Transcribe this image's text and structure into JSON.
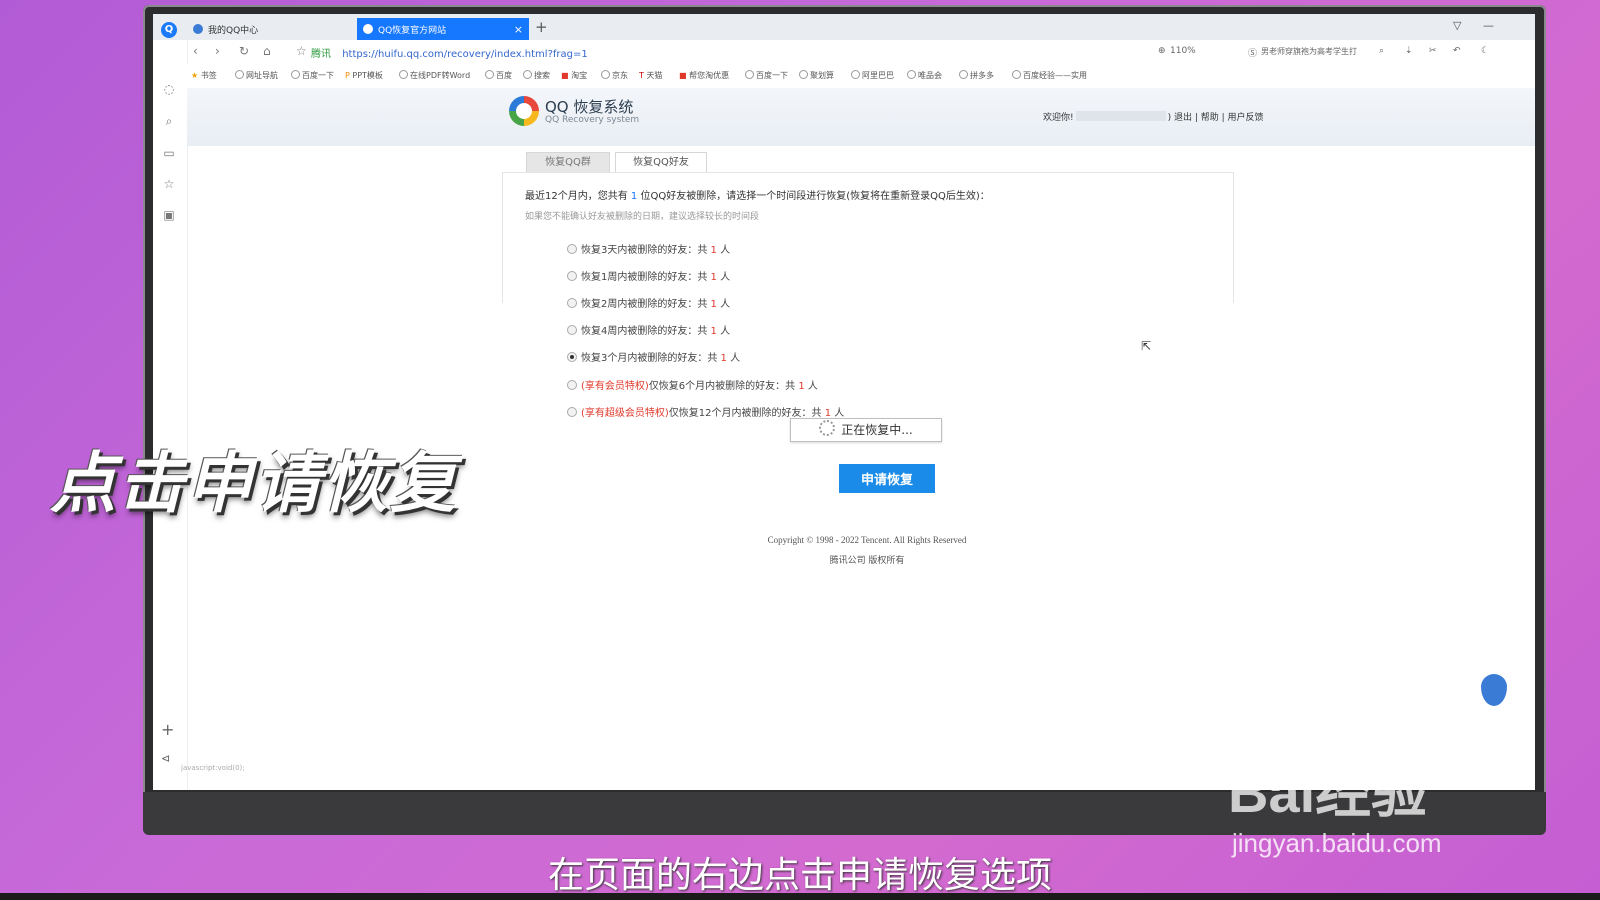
{
  "browser": {
    "tabs": [
      {
        "label": "我的QQ中心"
      },
      {
        "label": "QQ恢复官方网站"
      }
    ],
    "new_tab": "+",
    "site_name": "腾讯",
    "url": "https://huifu.qq.com/recovery/index.html?frag=1",
    "zoom": "110%",
    "search_hint": "男老师穿旗袍为高考学生打",
    "bookmarks": [
      "书签",
      "网址导航",
      "百度一下",
      "PPT模板",
      "在线PDF转Word",
      "百度",
      "搜索",
      "淘宝",
      "京东",
      "天猫",
      "帮您淘优惠",
      "百度一下",
      "聚划算",
      "阿里巴巴",
      "唯品会",
      "拼多多",
      "百度经验——实用"
    ],
    "status_url": "javascript:void(0);"
  },
  "page": {
    "logo_title": "QQ 恢复系统",
    "logo_sub": "QQ Recovery system",
    "welcome_prefix": "欢迎你!",
    "welcome_suffix": ") 退出 | 帮助 | 用户反馈",
    "tabs": [
      "恢复QQ群",
      "恢复QQ好友"
    ],
    "intro_pre": "最近12个月内，您共有 ",
    "intro_num": "1",
    "intro_post": " 位QQ好友被删除，请选择一个时间段进行恢复(恢复将在重新登录QQ后生效)：",
    "hint": "如果您不能确认好友被删除的日期，建议选择较长的时间段",
    "options": [
      {
        "pre": "",
        "label": "恢复3天内被删除的好友：共 ",
        "count": "1",
        "post": " 人"
      },
      {
        "pre": "",
        "label": "恢复1周内被删除的好友：共 ",
        "count": "1",
        "post": " 人"
      },
      {
        "pre": "",
        "label": "恢复2周内被删除的好友：共 ",
        "count": "1",
        "post": " 人"
      },
      {
        "pre": "",
        "label": "恢复4周内被删除的好友：共 ",
        "count": "1",
        "post": " 人"
      },
      {
        "pre": "",
        "label": "恢复3个月内被删除的好友：共 ",
        "count": "1",
        "post": " 人"
      },
      {
        "pre": "(享有会员特权)",
        "label": "仅恢复6个月内被删除的好友：共 ",
        "count": "1",
        "post": " 人"
      },
      {
        "pre": "(享有超级会员特权)",
        "label": "仅恢复12个月内被删除的好友：共 ",
        "count": "1",
        "post": " 人"
      }
    ],
    "selected_option": 4,
    "loading_text": "正在恢复中...",
    "apply_button": "申请恢复",
    "copyright": "Copyright © 1998 - 2022 Tencent. All Rights Reserved",
    "company": "腾讯公司 版权所有"
  },
  "overlay": {
    "caption": "点击申请恢复",
    "subtitle": "在页面的右边点击申请恢复选项",
    "watermark": "Bai经验",
    "watermark_url": "jingyan.baidu.com"
  },
  "colors": {
    "accent": "#1a8be8",
    "warning_red": "#e0392b",
    "background": "#c86ad8"
  }
}
